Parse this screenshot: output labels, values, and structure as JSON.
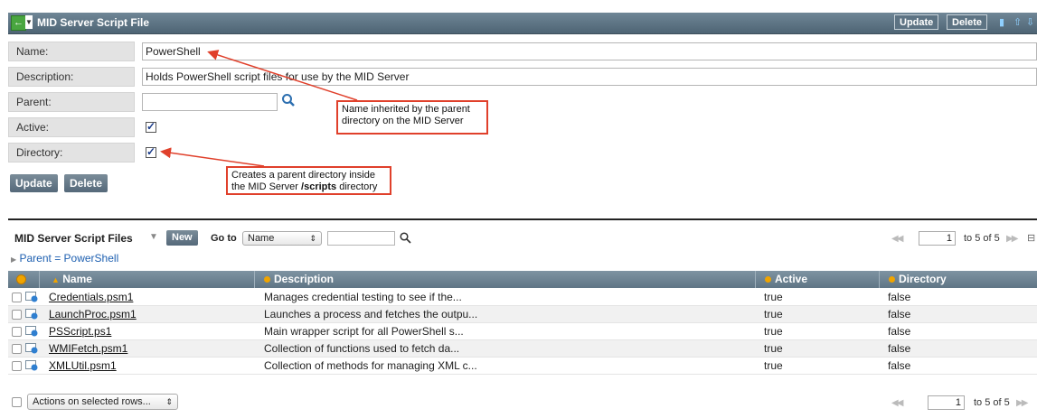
{
  "header": {
    "title": "MID Server Script File",
    "update_label": "Update",
    "delete_label": "Delete"
  },
  "form": {
    "name_label": "Name:",
    "name_value": "PowerShell",
    "description_label": "Description:",
    "description_value": "Holds PowerShell script files for use by the MID Server",
    "parent_label": "Parent:",
    "parent_value": "",
    "active_label": "Active:",
    "active_checked": true,
    "directory_label": "Directory:",
    "directory_checked": true,
    "update_label": "Update",
    "delete_label": "Delete"
  },
  "annotations": {
    "name_note": "Name inherited by the parent directory on the MID Server",
    "directory_note_1": "Creates a parent directory inside",
    "directory_note_2_prefix": "the MID Server ",
    "directory_note_2_bold": "/scripts",
    "directory_note_2_suffix": " directory",
    "accent_color": "#e0402b"
  },
  "list": {
    "title": "MID Server Script Files",
    "new_label": "New",
    "goto_label": "Go to",
    "goto_field": "Name",
    "goto_value": "",
    "breadcrumb": "Parent = PowerShell",
    "pagination": {
      "current": "1",
      "range_text": "to 5 of 5"
    },
    "columns": [
      "Name",
      "Description",
      "Active",
      "Directory"
    ],
    "rows": [
      {
        "name": "Credentials.psm1",
        "description": "Manages credential testing to see if the...",
        "active": "true",
        "directory": "false"
      },
      {
        "name": "LaunchProc.psm1",
        "description": "Launches a process and fetches the outpu...",
        "active": "true",
        "directory": "false"
      },
      {
        "name": "PSScript.ps1",
        "description": "Main wrapper script for all PowerShell s...",
        "active": "true",
        "directory": "false"
      },
      {
        "name": "WMIFetch.psm1",
        "description": "Collection of functions used to fetch da...",
        "active": "true",
        "directory": "false"
      },
      {
        "name": "XMLUtil.psm1",
        "description": "Collection of methods for managing XML c...",
        "active": "true",
        "directory": "false"
      }
    ],
    "actions_label": "Actions on selected rows..."
  }
}
